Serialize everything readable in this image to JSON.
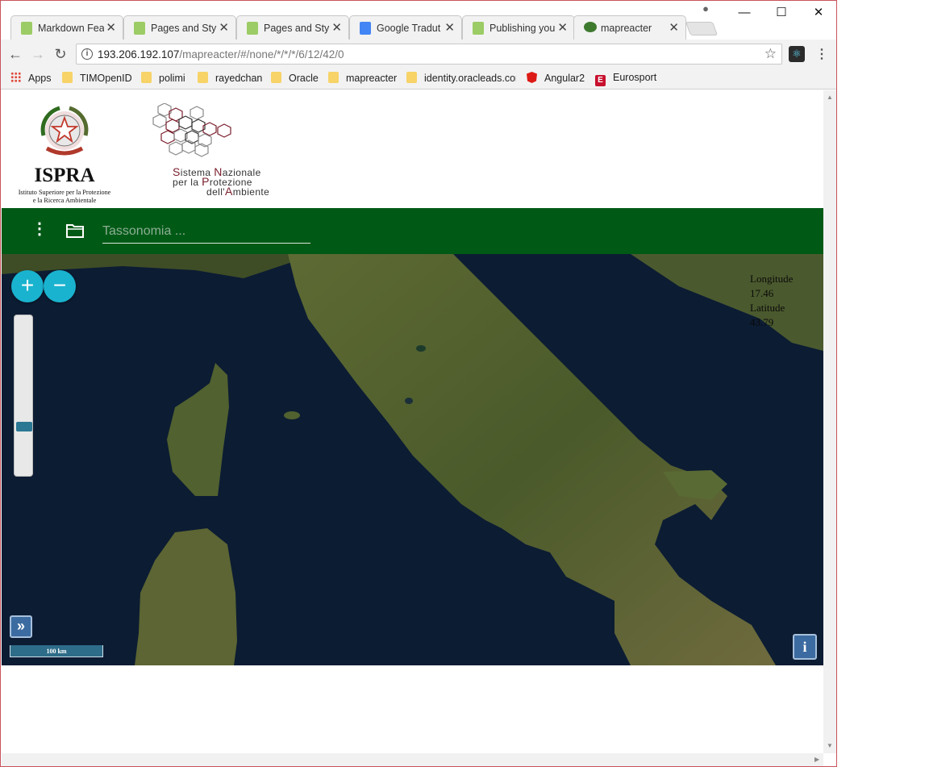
{
  "browser": {
    "tabs": [
      {
        "title": "Markdown Fea",
        "icon": "sheets-icon",
        "icon_color": "#9ccc65"
      },
      {
        "title": "Pages and Styl",
        "icon": "sheets-icon",
        "icon_color": "#9ccc65"
      },
      {
        "title": "Pages and Styl",
        "icon": "sheets-icon",
        "icon_color": "#9ccc65"
      },
      {
        "title": "Google Tradut",
        "icon": "google-translate-icon",
        "icon_color": "#4285f4"
      },
      {
        "title": "Publishing you",
        "icon": "sheets-icon",
        "icon_color": "#9ccc65"
      },
      {
        "title": "mapreacter",
        "icon": "tree-icon",
        "icon_color": "#3e7a2e"
      }
    ],
    "active_tab": 5,
    "tab_close_glyph": "✕",
    "window_controls": {
      "minimize": "—",
      "maximize": "☐",
      "close": "✕"
    },
    "url": {
      "host": "193.206.192.107",
      "path": "/mapreacter/#/none/*/*/*/6/12/42/0"
    },
    "bookmarks": [
      {
        "label": "Apps",
        "icon": "apps-grid-icon"
      },
      {
        "label": "TIMOpenID",
        "icon": "folder-icon"
      },
      {
        "label": "polimi",
        "icon": "folder-icon"
      },
      {
        "label": "rayedchan",
        "icon": "folder-icon"
      },
      {
        "label": "Oracle",
        "icon": "folder-icon"
      },
      {
        "label": "mapreacter",
        "icon": "folder-icon"
      },
      {
        "label": "identity.oracleads.cor",
        "icon": "folder-icon"
      },
      {
        "label": "Angular2",
        "icon": "angular-icon"
      },
      {
        "label": "Eurosport",
        "icon": "eurosport-icon"
      }
    ],
    "colors": {
      "chrome_bg": "#f2f2f2",
      "window_border": "#c8535d"
    }
  },
  "header": {
    "ispra": {
      "name": "ISPRA",
      "subtitle_line1": "Istituto Superiore per la Protezione",
      "subtitle_line2": "e la Ricerca Ambientale"
    },
    "snpa": {
      "line1_cap": "S",
      "line1_rest": "istema ",
      "line1_cap2": "N",
      "line1_rest2": "azionale",
      "line2_pre": "per la ",
      "line2_cap": "P",
      "line2_rest": "rotezione",
      "line3_pre": "dell'",
      "line3_cap": "A",
      "line3_rest": "mbiente"
    }
  },
  "appbar": {
    "menu_glyph": "⋮",
    "search_placeholder": "Tassonomia ...",
    "color": "#005a16"
  },
  "map": {
    "zoom_in": "+",
    "zoom_out": "−",
    "zoom_level_fraction": 0.71,
    "longitude_label": "Longitude",
    "longitude_value": "17.46",
    "latitude_label": "Latitude",
    "latitude_value": "43.79",
    "expand_glyph": "»",
    "scale_label": "100 km",
    "info_glyph": "i",
    "colors": {
      "sea": "#0c1c33",
      "land": "#4d5a2c",
      "control": "#1ab3cf",
      "button": "#3b6ba0"
    }
  }
}
